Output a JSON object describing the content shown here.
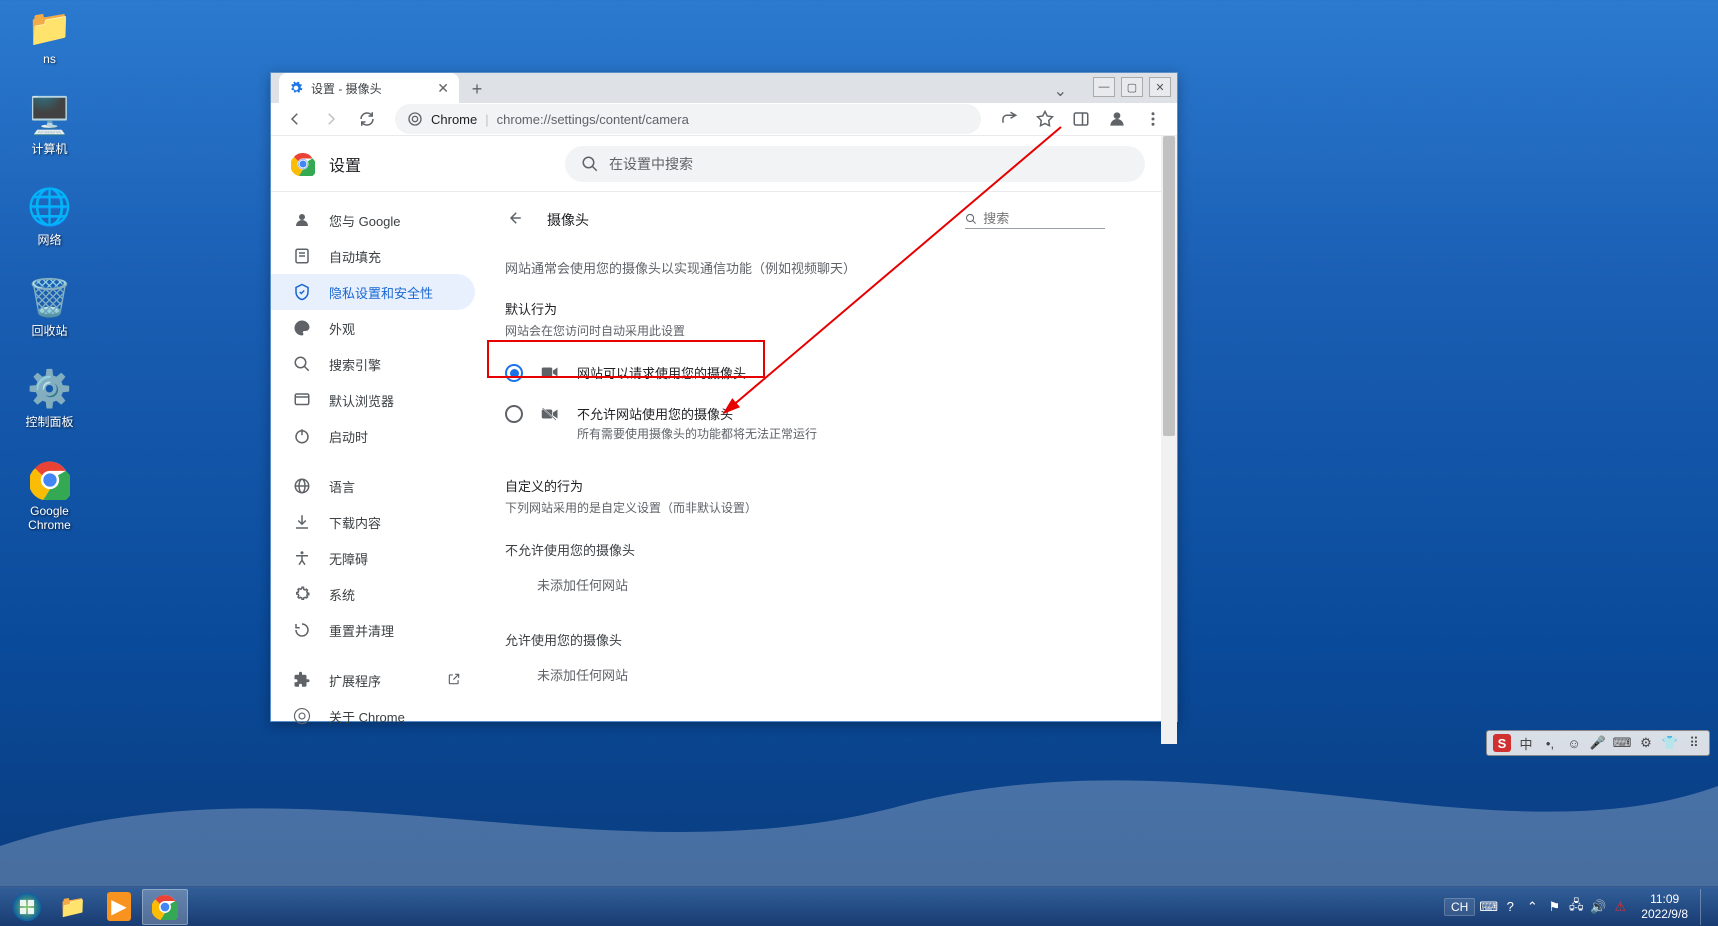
{
  "desktop": [
    {
      "label": "ns",
      "icon": "folder"
    },
    {
      "label": "计算机",
      "icon": "computer"
    },
    {
      "label": "网络",
      "icon": "network"
    },
    {
      "label": "回收站",
      "icon": "recycle"
    },
    {
      "label": "控制面板",
      "icon": "control"
    },
    {
      "label": "Google Chrome",
      "icon": "chrome"
    }
  ],
  "tab": {
    "title": "设置 - 摄像头"
  },
  "omnibox": {
    "prefix": "Chrome",
    "sep": " | ",
    "url": "chrome://settings/content/camera"
  },
  "settings": {
    "title": "设置",
    "search_placeholder": "在设置中搜索",
    "sidebar": [
      {
        "id": "you",
        "label": "您与 Google"
      },
      {
        "id": "autofill",
        "label": "自动填充"
      },
      {
        "id": "privacy",
        "label": "隐私设置和安全性",
        "active": true
      },
      {
        "id": "appearance",
        "label": "外观"
      },
      {
        "id": "searchengine",
        "label": "搜索引擎"
      },
      {
        "id": "defaultbrowser",
        "label": "默认浏览器"
      },
      {
        "id": "onstartup",
        "label": "启动时"
      },
      {
        "id": "SEP"
      },
      {
        "id": "languages",
        "label": "语言"
      },
      {
        "id": "downloads",
        "label": "下载内容"
      },
      {
        "id": "accessibility",
        "label": "无障碍"
      },
      {
        "id": "system",
        "label": "系统"
      },
      {
        "id": "reset",
        "label": "重置并清理"
      },
      {
        "id": "SEP"
      },
      {
        "id": "extensions",
        "label": "扩展程序",
        "ext": true
      },
      {
        "id": "about",
        "label": "关于 Chrome"
      }
    ]
  },
  "page": {
    "title": "摄像头",
    "search_placeholder": "搜索",
    "intro": "网站通常会使用您的摄像头以实现通信功能（例如视频聊天）",
    "default_title": "默认行为",
    "default_sub": "网站会在您访问时自动采用此设置",
    "radio_allow": "网站可以请求使用您的摄像头",
    "radio_block": "不允许网站使用您的摄像头",
    "radio_block_sub": "所有需要使用摄像头的功能都将无法正常运行",
    "custom_title": "自定义的行为",
    "custom_sub": "下列网站采用的是自定义设置（而非默认设置）",
    "block_list_title": "不允许使用您的摄像头",
    "allow_list_title": "允许使用您的摄像头",
    "empty": "未添加任何网站"
  },
  "ime": {
    "items": [
      "中",
      "",
      "☺",
      "🎤",
      "⌨",
      "",
      "👕",
      "⠿"
    ]
  },
  "tray": {
    "lang": "CH",
    "time": "11:09",
    "date": "2022/9/8"
  }
}
